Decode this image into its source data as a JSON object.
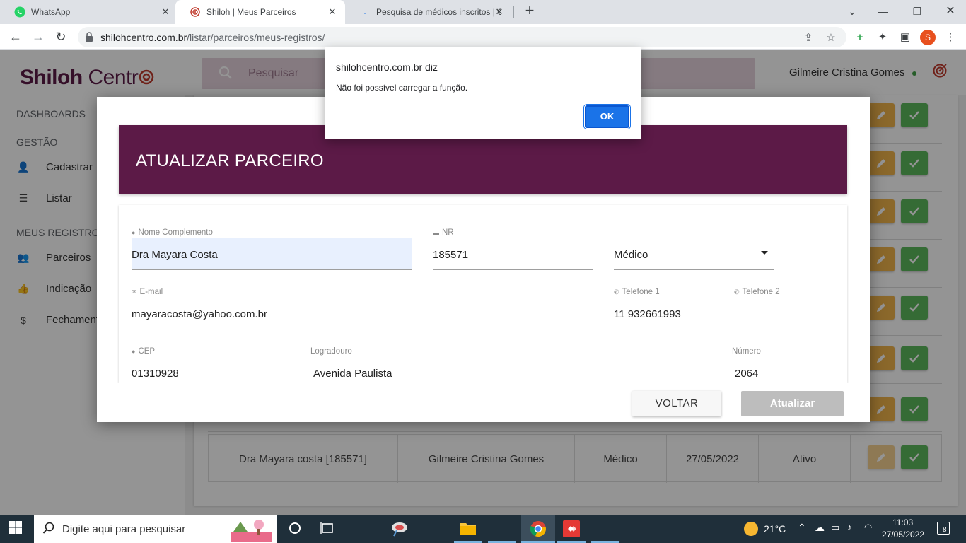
{
  "browser": {
    "tabs": [
      {
        "title": "WhatsApp",
        "active": false
      },
      {
        "title": "Shiloh | Meus Parceiros",
        "active": true
      },
      {
        "title": "Pesquisa de médicos inscritos | C",
        "active": false
      }
    ],
    "url_host": "shilohcentro.com.br",
    "url_path": "/listar/parceiros/meus-registros/",
    "profile_initial": "S"
  },
  "app": {
    "logo_main": "Shiloh",
    "logo_second": "Centr",
    "search_placeholder": "Pesquisar",
    "user_name": "Gilmeire Cristina Gomes",
    "sidebar": {
      "section_dashboards": "DASHBOARDS",
      "section_gestao": "GESTÃO",
      "item_cadastrar": "Cadastrar",
      "item_listar": "Listar",
      "section_registros": "MEUS REGISTROS",
      "item_parceiros": "Parceiros",
      "item_indicacao": "Indicação",
      "item_fechamento": "Fechamento"
    },
    "last_row": {
      "name": "Dra Mayara costa [185571]",
      "owner": "Gilmeire Cristina Gomes",
      "type": "Médico",
      "date": "27/05/2022",
      "status": "Ativo"
    }
  },
  "modal": {
    "title": "ATUALIZAR PARCEIRO",
    "fields": {
      "nome_label": "Nome Complemento",
      "nome_value": "Dra Mayara Costa",
      "nr_label": "NR",
      "nr_value": "185571",
      "tipo_value": "Médico",
      "email_label": "E-mail",
      "email_value": "mayaracosta@yahoo.com.br",
      "tel1_label": "Telefone 1",
      "tel1_value": "11 932661993",
      "tel2_label": "Telefone 2",
      "tel2_value": "",
      "cep_label": "CEP",
      "cep_value": "01310928",
      "logradouro_label": "Logradouro",
      "logradouro_value": "Avenida Paulista",
      "numero_label": "Número",
      "numero_value": "2064"
    },
    "btn_voltar": "VOLTAR",
    "btn_atualizar": "Atualizar"
  },
  "alert": {
    "title": "shilohcentro.com.br diz",
    "message": "Não foi possível carregar a função.",
    "ok": "OK"
  },
  "taskbar": {
    "search_placeholder": "Digite aqui para pesquisar",
    "temperature": "21°C",
    "time": "11:03",
    "date": "27/05/2022",
    "notifications": "8"
  },
  "colors": {
    "brand": "#5c1a47",
    "edit": "#f0b34a",
    "ok": "#5cb85c",
    "alert_button": "#1a73e8"
  }
}
